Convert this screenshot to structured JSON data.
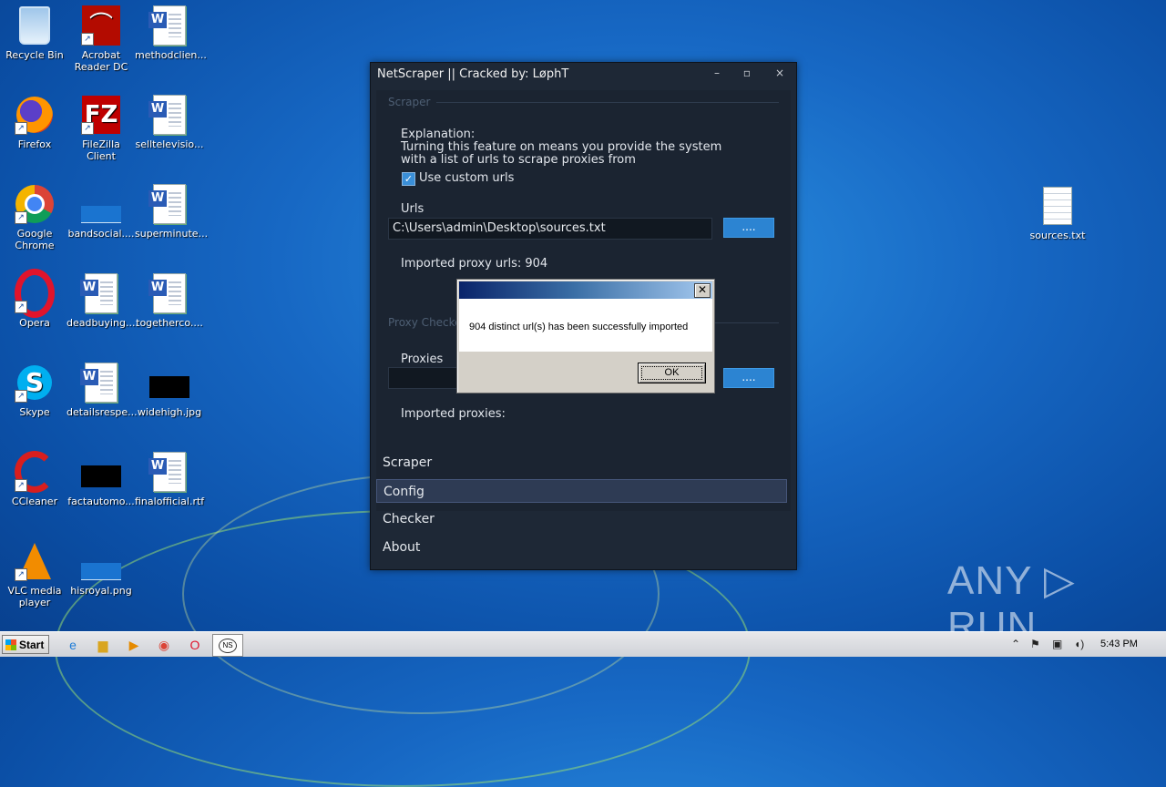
{
  "desktop": {
    "icons": [
      {
        "label": "Recycle Bin",
        "icon": "recycle-bin-icon"
      },
      {
        "label": "Acrobat Reader DC",
        "icon": "acrobat-icon"
      },
      {
        "label": "methodclien...",
        "icon": "word-doc-icon"
      },
      {
        "label": "Firefox",
        "icon": "firefox-icon"
      },
      {
        "label": "FileZilla Client",
        "icon": "filezilla-icon"
      },
      {
        "label": "selltelevisio...",
        "icon": "word-doc-icon"
      },
      {
        "label": "Google Chrome",
        "icon": "chrome-icon"
      },
      {
        "label": "bandsocial....",
        "icon": "image-file-icon"
      },
      {
        "label": "superminute...",
        "icon": "word-doc-icon"
      },
      {
        "label": "Opera",
        "icon": "opera-icon"
      },
      {
        "label": "deadbuying....",
        "icon": "word-doc-icon"
      },
      {
        "label": "togetherco....",
        "icon": "word-doc-icon"
      },
      {
        "label": "Skype",
        "icon": "skype-icon"
      },
      {
        "label": "detailsrespe...",
        "icon": "word-doc-icon"
      },
      {
        "label": "widehigh.jpg",
        "icon": "image-file-icon"
      },
      {
        "label": "CCleaner",
        "icon": "ccleaner-icon"
      },
      {
        "label": "factautomo...",
        "icon": "image-file-icon"
      },
      {
        "label": "finalofficial.rtf",
        "icon": "word-doc-icon"
      },
      {
        "label": "VLC media player",
        "icon": "vlc-icon"
      },
      {
        "label": "hisroyal.png",
        "icon": "image-file-icon"
      },
      {
        "label": "sources.txt",
        "icon": "text-file-icon"
      }
    ]
  },
  "app": {
    "title": "NetScraper || Cracked by: LøphT",
    "min_glyph": "–",
    "max_glyph": "▫",
    "close_glyph": "×",
    "scraper_group": {
      "title": "Scraper",
      "explanation_label": "Explanation:",
      "explanation_line1": "Turning this feature on means you provide the system",
      "explanation_line2": "with a list of urls to scrape proxies from",
      "checkbox_label": "Use custom urls",
      "checkbox_checked": true,
      "urls_label": "Urls",
      "urls_value": "C:\\Users\\admin\\Desktop\\sources.txt",
      "browse_label": "....",
      "imported_urls": "Imported proxy urls: 904"
    },
    "checker_group": {
      "title": "Proxy Checker",
      "proxies_label": "Proxies",
      "proxies_value": "",
      "browse_label": "....",
      "imported_proxies": "Imported proxies:"
    },
    "nav": [
      "Scraper",
      "Config",
      "Checker",
      "About"
    ],
    "active_nav": "Config"
  },
  "dialog": {
    "title": "",
    "message": "904 distinct url(s) has been successfully imported",
    "ok_label": "OK",
    "close_glyph": "✕"
  },
  "taskbar": {
    "start_label": "Start",
    "active_app": "NS",
    "clock": "5:43 PM"
  },
  "watermark": "ANY ▷ RUN"
}
